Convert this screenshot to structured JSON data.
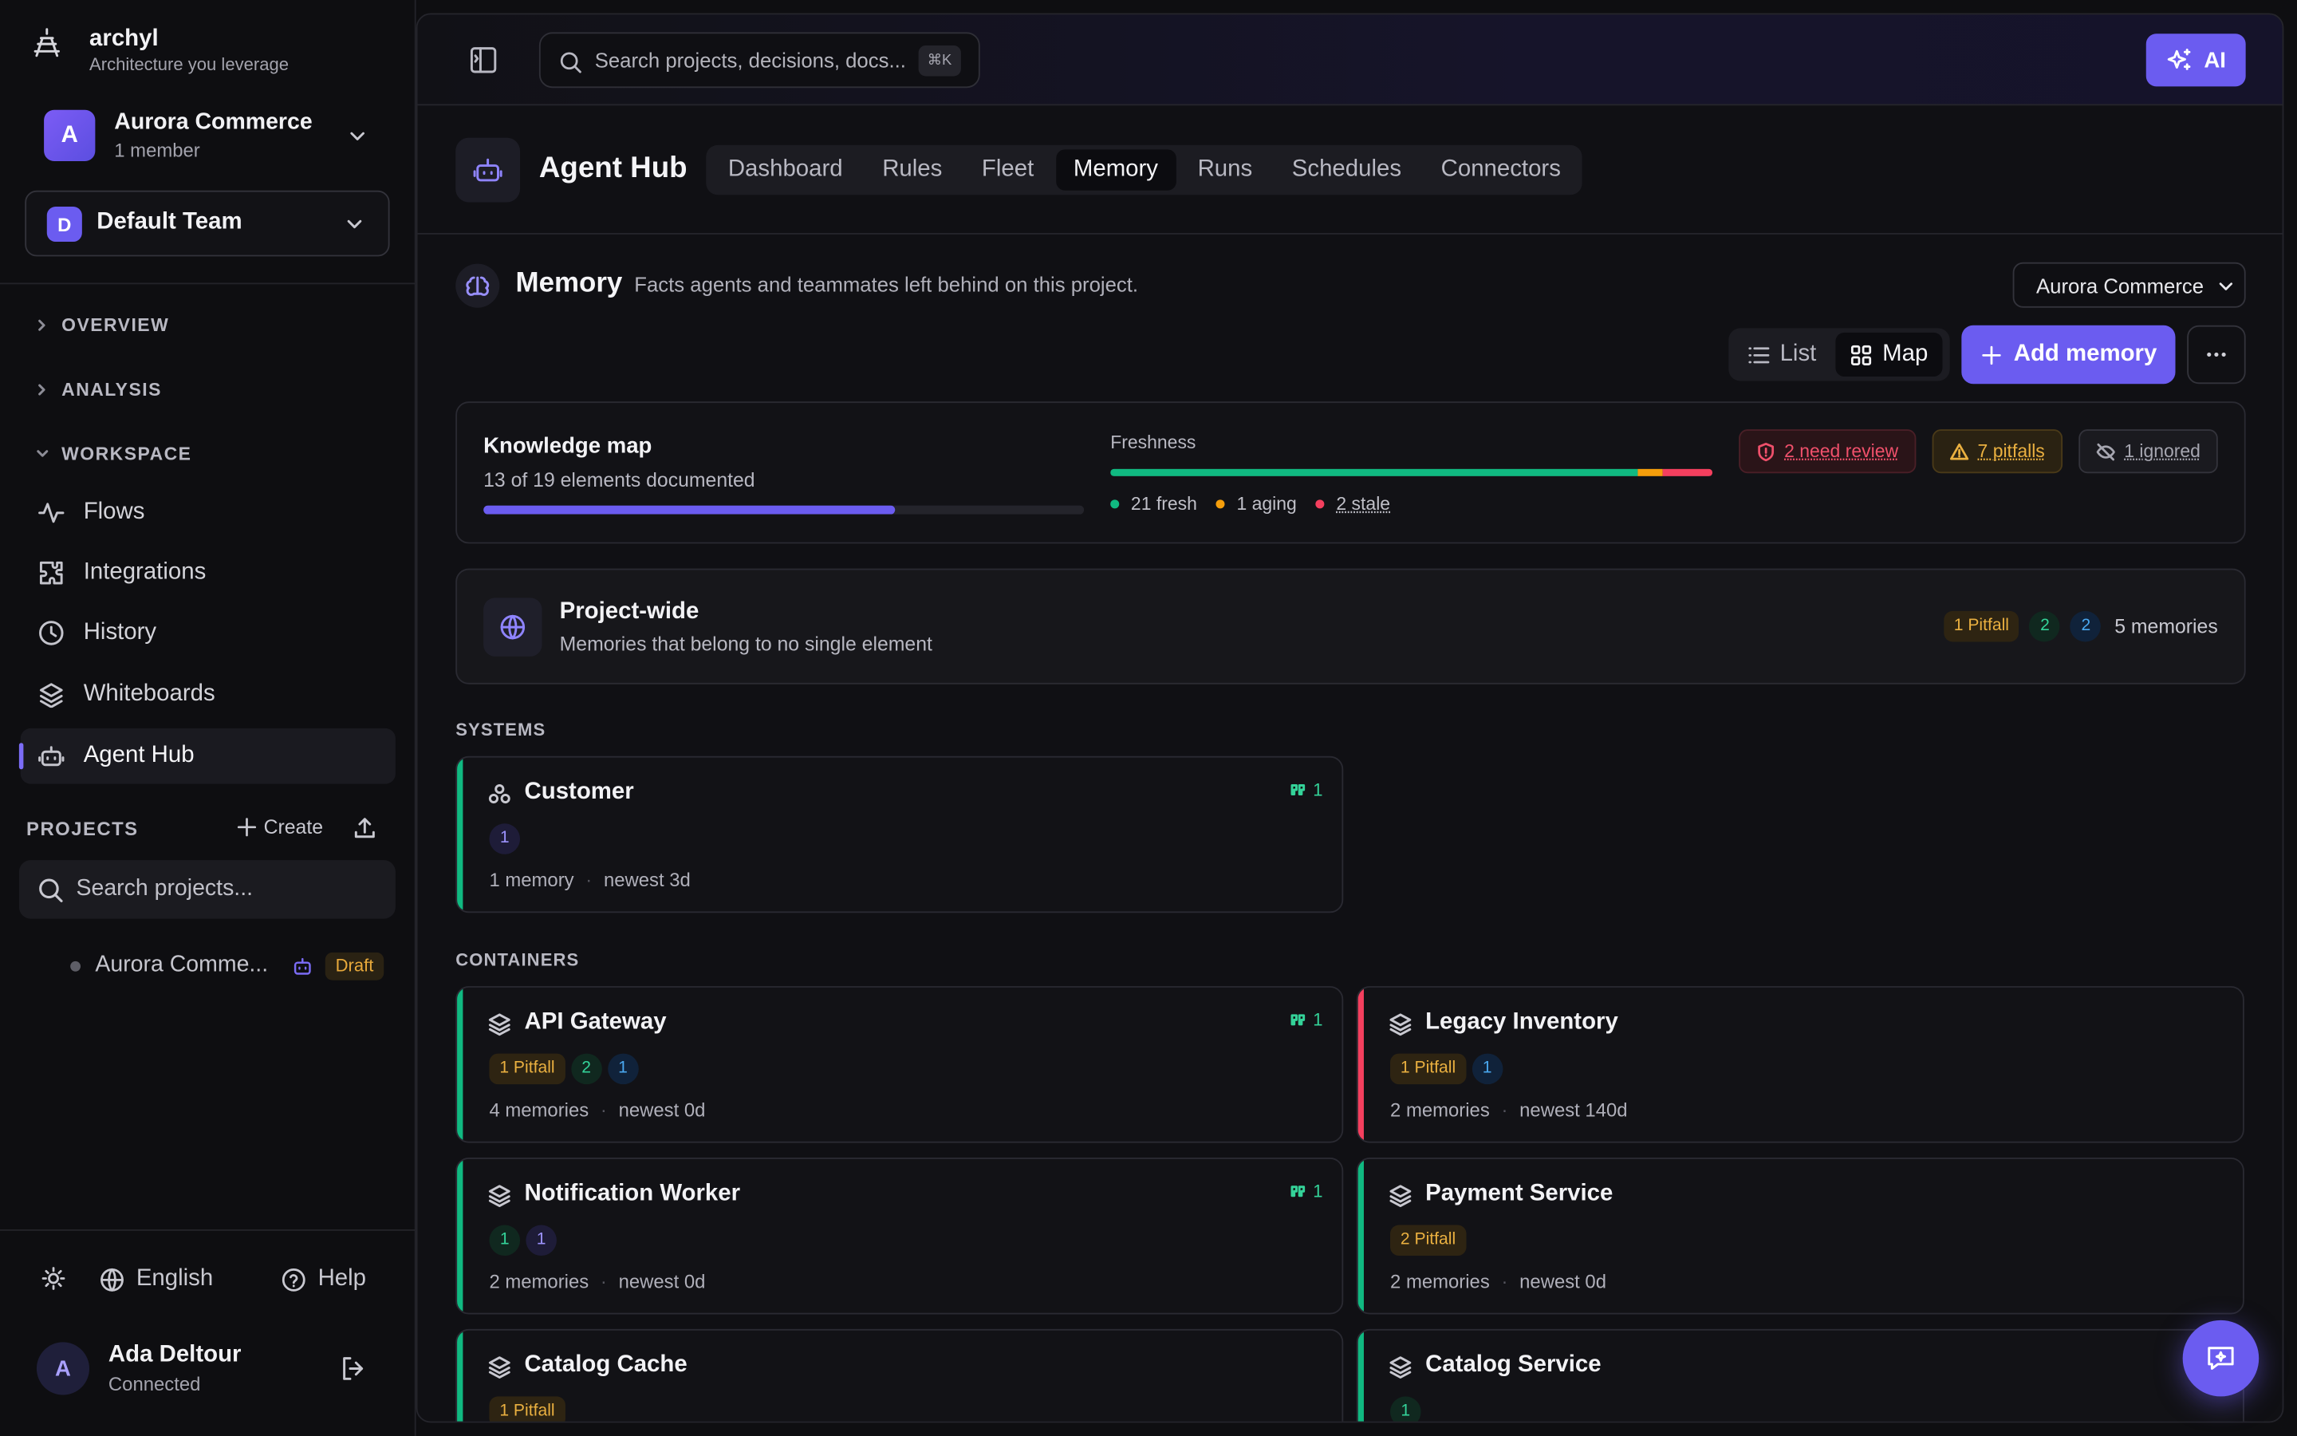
{
  "brand": {
    "name": "archyl",
    "tagline": "Architecture you leverage"
  },
  "org": {
    "initial": "A",
    "name": "Aurora Commerce",
    "members": "1 member"
  },
  "team": {
    "initial": "D",
    "name": "Default Team"
  },
  "sidebar": {
    "sections": [
      {
        "label": "OVERVIEW"
      },
      {
        "label": "ANALYSIS"
      },
      {
        "label": "WORKSPACE"
      }
    ],
    "items": [
      {
        "label": "Flows",
        "icon": "activity-icon"
      },
      {
        "label": "Integrations",
        "icon": "puzzle-icon"
      },
      {
        "label": "History",
        "icon": "clock-icon"
      },
      {
        "label": "Whiteboards",
        "icon": "layers-icon"
      },
      {
        "label": "Agent Hub",
        "icon": "bot-icon",
        "active": true
      }
    ],
    "projects_label": "PROJECTS",
    "create_label": "Create",
    "search_placeholder": "Search projects...",
    "project": {
      "name": "Aurora Comme...",
      "badge": "Draft"
    }
  },
  "footer": {
    "language": "English",
    "help": "Help"
  },
  "user": {
    "initial": "A",
    "name": "Ada Deltour",
    "status": "Connected"
  },
  "topbar": {
    "search_placeholder": "Search projects, decisions, docs...",
    "shortcut": "⌘K",
    "ai_label": "AI"
  },
  "hub": {
    "title": "Agent Hub",
    "tabs": [
      "Dashboard",
      "Rules",
      "Fleet",
      "Memory",
      "Runs",
      "Schedules",
      "Connectors"
    ],
    "active_tab": "Memory"
  },
  "memory": {
    "title": "Memory",
    "subtitle": "Facts agents and teammates left behind on this project.",
    "project_select": "Aurora Commerce",
    "view_list": "List",
    "view_map": "Map",
    "add_label": "Add memory"
  },
  "knowledge_map": {
    "title": "Knowledge map",
    "summary": "13 of 19 elements documented",
    "documented": 13,
    "total": 19,
    "freshness_label": "Freshness",
    "fresh": 21,
    "aging": 1,
    "stale": 2,
    "fresh_label": "21 fresh",
    "aging_label": "1 aging",
    "stale_label": "2 stale",
    "review_label": "2 need review",
    "pitfalls_label": "7 pitfalls",
    "ignored_label": "1 ignored"
  },
  "project_wide": {
    "title": "Project-wide",
    "subtitle": "Memories that belong to no single element",
    "pitfall": "1 Pitfall",
    "green": "2",
    "blue": "2",
    "count": "5 memories"
  },
  "groups": {
    "systems": "SYSTEMS",
    "containers": "CONTAINERS"
  },
  "cards": {
    "customer": {
      "title": "Customer",
      "pills": [
        "1"
      ],
      "memories": "1 memory",
      "newest": "newest 3d",
      "quotes": "1"
    },
    "api_gateway": {
      "title": "API Gateway",
      "pills": [
        "1 Pitfall",
        "2",
        "1"
      ],
      "memories": "4 memories",
      "newest": "newest 0d",
      "quotes": "1"
    },
    "legacy_inventory": {
      "title": "Legacy Inventory",
      "pills": [
        "1 Pitfall",
        "1"
      ],
      "memories": "2 memories",
      "newest": "newest 140d"
    },
    "notification_worker": {
      "title": "Notification Worker",
      "pills": [
        "1",
        "1"
      ],
      "memories": "2 memories",
      "newest": "newest 0d",
      "quotes": "1"
    },
    "payment_service": {
      "title": "Payment Service",
      "pills": [
        "2 Pitfall"
      ],
      "memories": "2 memories",
      "newest": "newest 0d"
    },
    "catalog_cache": {
      "title": "Catalog Cache",
      "pills": [
        "1 Pitfall"
      ]
    },
    "catalog_service": {
      "title": "Catalog Service",
      "pills": [
        "1"
      ]
    }
  },
  "colors": {
    "accent": "#6b5cf0",
    "fresh": "#10b981",
    "aging": "#f59e0b",
    "stale": "#f43f5e",
    "pitfall": "#eab040"
  }
}
